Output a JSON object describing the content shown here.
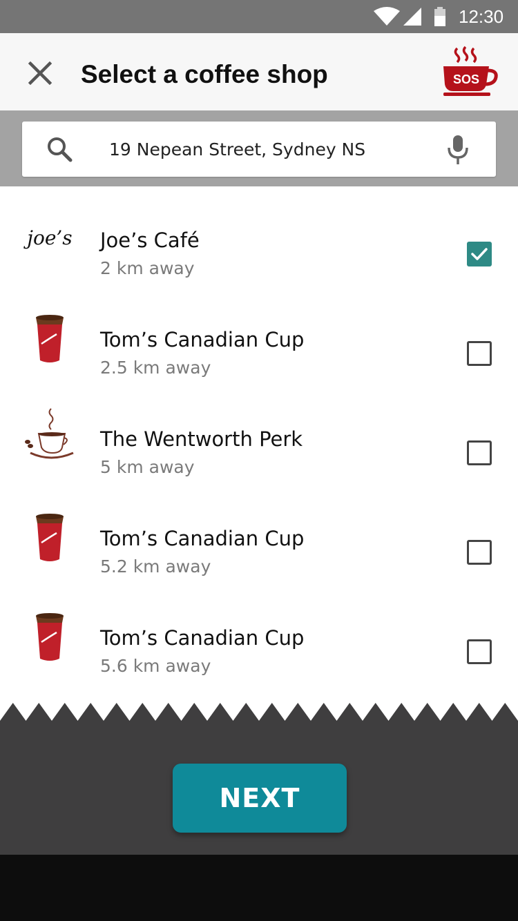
{
  "status_bar": {
    "time": "12:30",
    "icons": [
      "wifi-icon",
      "cell-signal-icon",
      "battery-icon"
    ]
  },
  "header": {
    "close_icon": "close-icon",
    "title": "Select a coffee shop",
    "logo_text": "SOS",
    "brand_color": "#b5121b"
  },
  "search": {
    "value": "19 Nepean Street, Sydney NS",
    "search_icon": "search-icon",
    "mic_icon": "microphone-icon"
  },
  "shops": [
    {
      "name": "Joe’s Café",
      "distance": "2 km away",
      "logo": "joes-logo",
      "logo_text": "joe’s",
      "checked": true
    },
    {
      "name": "Tom’s Canadian Cup",
      "distance": "2.5 km away",
      "logo": "coffee-cup-logo",
      "checked": false
    },
    {
      "name": "The Wentworth Perk",
      "distance": "5 km away",
      "logo": "steaming-cup-logo",
      "checked": false
    },
    {
      "name": "Tom’s Canadian Cup",
      "distance": "5.2 km away",
      "logo": "coffee-cup-logo",
      "checked": false
    },
    {
      "name": "Tom’s Canadian Cup",
      "distance": "5.6 km away",
      "logo": "coffee-cup-logo",
      "checked": false
    }
  ],
  "footer": {
    "next_label": "NEXT",
    "button_color": "#0f8a99",
    "check_color": "#2e8a85"
  }
}
